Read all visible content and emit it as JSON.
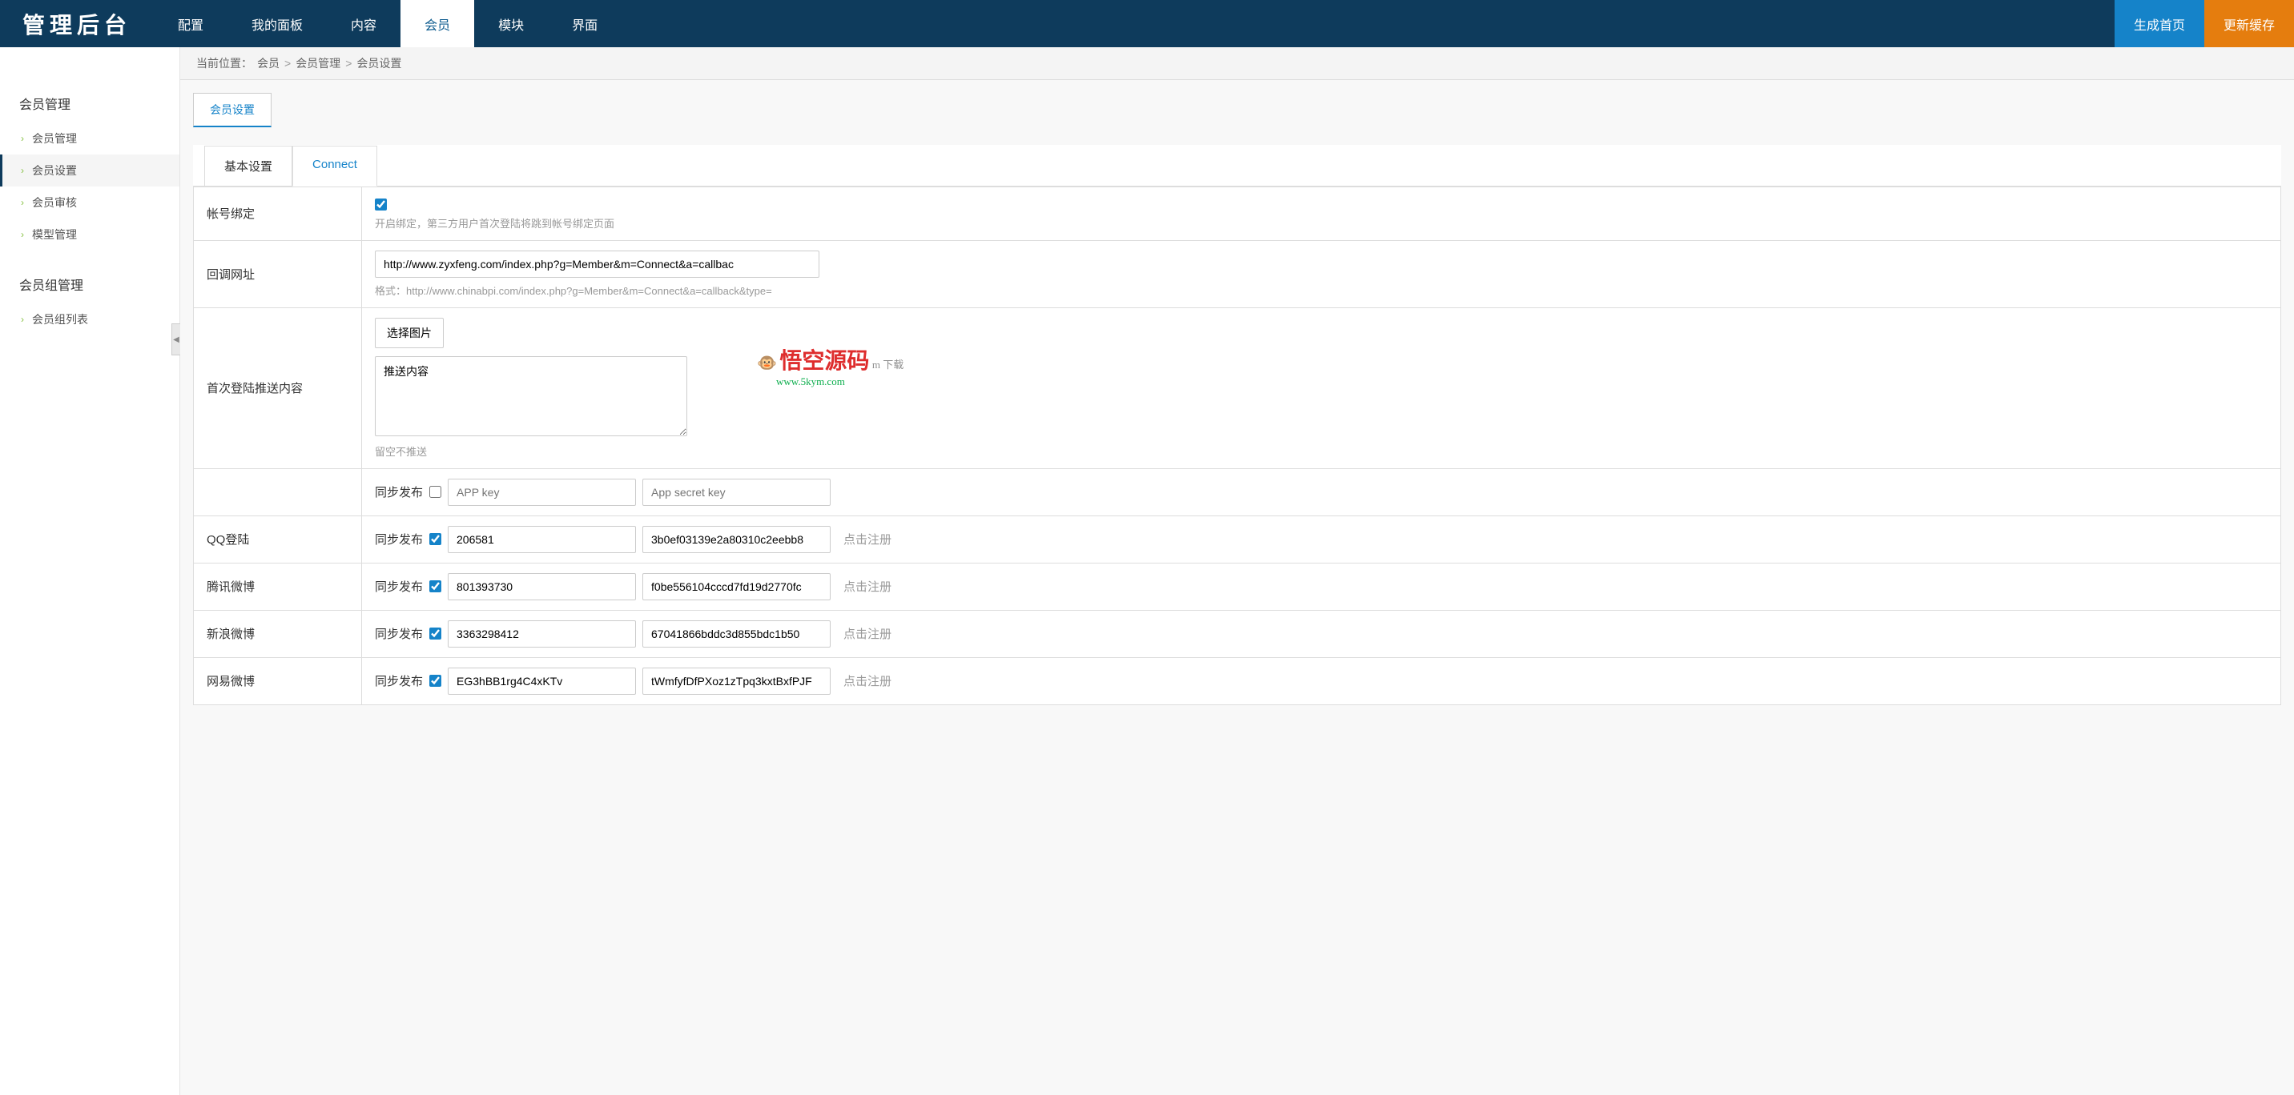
{
  "header": {
    "logo": "管理后台",
    "nav": [
      "配置",
      "我的面板",
      "内容",
      "会员",
      "模块",
      "界面"
    ],
    "nav_active": 3,
    "btn_generate": "生成首页",
    "btn_update_cache": "更新缓存"
  },
  "breadcrumb": {
    "prefix": "当前位置：",
    "items": [
      "会员",
      "会员管理",
      "会员设置"
    ]
  },
  "sidebar": {
    "sections": [
      {
        "title": "会员管理",
        "items": [
          "会员管理",
          "会员设置",
          "会员审核",
          "模型管理"
        ],
        "active": 1
      },
      {
        "title": "会员组管理",
        "items": [
          "会员组列表"
        ],
        "active": -1
      }
    ]
  },
  "page_tab": "会员设置",
  "inner_tabs": {
    "items": [
      "基本设置",
      "Connect"
    ],
    "active": 1
  },
  "form": {
    "account_binding": {
      "label": "帐号绑定",
      "checked": true,
      "hint": "开启绑定，第三方用户首次登陆将跳到帐号绑定页面"
    },
    "callback_url": {
      "label": "回调网址",
      "value": "http://www.zyxfeng.com/index.php?g=Member&m=Connect&a=callbac",
      "hint": "格式：http://www.chinabpi.com/index.php?g=Member&m=Connect&a=callback&type="
    },
    "first_login_push": {
      "label": "首次登陆推送内容",
      "select_image": "选择图片",
      "textarea_value": "推送内容",
      "hint": "留空不推送"
    },
    "sync_label": "同步发布",
    "app_key_placeholder": "APP key",
    "app_secret_placeholder": "App secret key",
    "register_link": "点击注册",
    "rows": [
      {
        "label": "",
        "checked": false,
        "key": "",
        "secret": "",
        "show_register": false
      },
      {
        "label": "QQ登陆",
        "checked": true,
        "key": "206581",
        "secret": "3b0ef03139e2a80310c2eebb8",
        "show_register": true
      },
      {
        "label": "腾讯微博",
        "checked": true,
        "key": "801393730",
        "secret": "f0be556104cccd7fd19d2770fc",
        "show_register": true
      },
      {
        "label": "新浪微博",
        "checked": true,
        "key": "3363298412",
        "secret": "67041866bddc3d855bdc1b50",
        "show_register": true
      },
      {
        "label": "网易微博",
        "checked": true,
        "key": "EG3hBB1rg4C4xKTv",
        "secret": "tWmfyfDfPXoz1zTpq3kxtBxfPJF",
        "show_register": true
      }
    ]
  },
  "watermark": {
    "line1": "悟空源码",
    "line2": "www.5kym.com",
    "suffix": "m 下载"
  }
}
